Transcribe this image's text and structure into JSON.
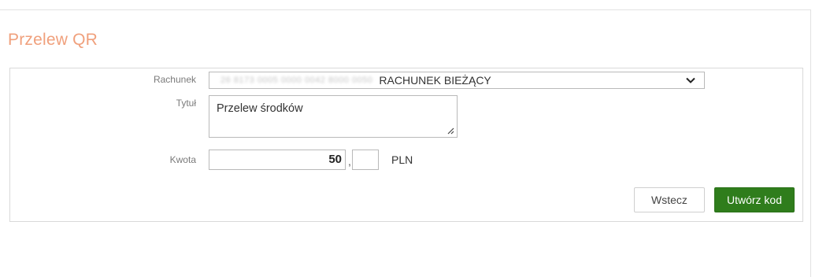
{
  "page": {
    "title": "Przelew QR"
  },
  "form": {
    "account": {
      "label": "Rachunek",
      "masked_number": "26 8173 0005 0000 0042 8000 0050",
      "account_name": "RACHUNEK BIEŻĄCY",
      "icon": "chevron-down-icon"
    },
    "title": {
      "label": "Tytuł",
      "value": "Przelew środków"
    },
    "amount": {
      "label": "Kwota",
      "value": "50",
      "separator": ",",
      "cents": "",
      "currency": "PLN"
    }
  },
  "actions": {
    "back_label": "Wstecz",
    "generate_label": "Utwórz kod"
  },
  "colors": {
    "title": "#f0a07c",
    "primary_button": "#2f7d1c"
  }
}
